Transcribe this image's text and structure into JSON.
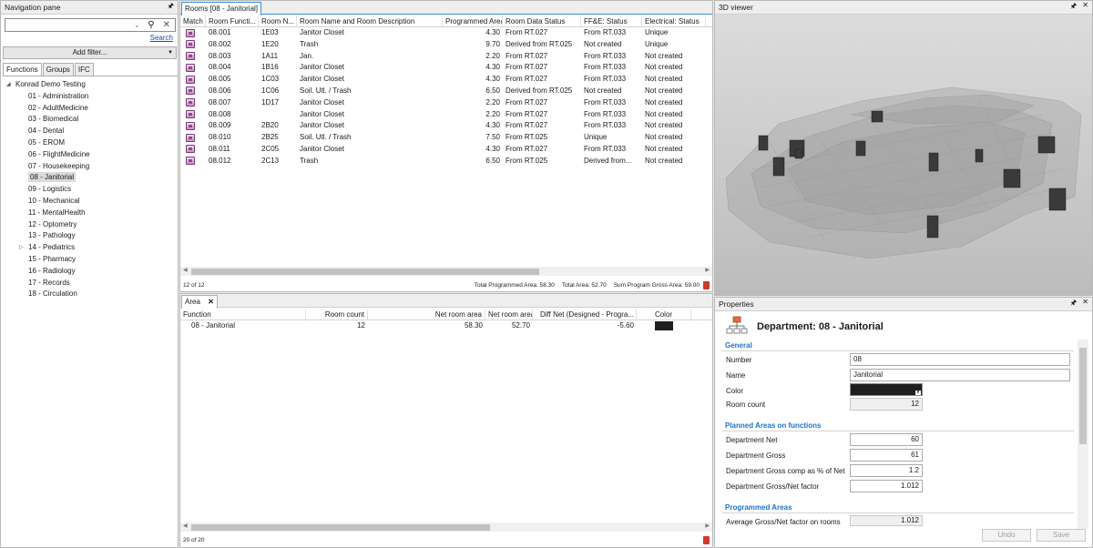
{
  "nav": {
    "title": "Navigation pane",
    "search_link": "Search",
    "add_filter": "Add filter...",
    "tabs": [
      "Functions",
      "Groups",
      "IFC"
    ],
    "root": "Konrad Demo Testing",
    "items": [
      "01 - Administration",
      "02 - AdultMedicine",
      "03 - Biomedical",
      "04 - Dental",
      "05 - EROM",
      "06 - FlightMedicine",
      "07 - Housekeeping",
      "08 - Janitorial",
      "09 - Logistics",
      "10 - Mechanical",
      "11 - MentalHealth",
      "12 - Optometry",
      "13 - Pathology",
      "14 - Pediatrics",
      "15 - Pharmacy",
      "16 - Radiology",
      "17 - Records",
      "18 - Circulation"
    ],
    "selected_index": 7
  },
  "rooms": {
    "tab": "Rooms [08 - Janitorial]",
    "columns": [
      "Match",
      "Room Functi...",
      "Room N...",
      "Room Name and Room Description",
      "Programmed Area",
      "Room Data Status",
      "FF&E: Status",
      "Electrical: Status"
    ],
    "rows": [
      [
        "08.001",
        "1E03",
        "Janitor Closet",
        "4.30",
        "From RT.027",
        "From RT.033",
        "Unique"
      ],
      [
        "08.002",
        "1E20",
        "Trash",
        "9.70",
        "Derived from RT.025",
        "Not created",
        "Unique"
      ],
      [
        "08.003",
        "1A11",
        "Jan.",
        "2.20",
        "From RT.027",
        "From RT.033",
        "Not created"
      ],
      [
        "08.004",
        "1B16",
        "Janitor Closet",
        "4.30",
        "From RT.027",
        "From RT.033",
        "Not created"
      ],
      [
        "08.005",
        "1C03",
        "Janitor Closet",
        "4.30",
        "From RT.027",
        "From RT.033",
        "Not created"
      ],
      [
        "08.006",
        "1C06",
        "Soil. Utl. / Trash",
        "6.50",
        "Derived from RT.025",
        "Not created",
        "Not created"
      ],
      [
        "08.007",
        "1D17",
        "Janitor Closet",
        "2.20",
        "From RT.027",
        "From RT.033",
        "Not created"
      ],
      [
        "08.008",
        "",
        "Janitor Closet",
        "2.20",
        "From RT.027",
        "From RT.033",
        "Not created"
      ],
      [
        "08.009",
        "2B20",
        "Janitor Closet",
        "4.30",
        "From RT.027",
        "From RT.033",
        "Not created"
      ],
      [
        "08.010",
        "2B25",
        "Soil. Utl. / Trash",
        "7.50",
        "From RT.025",
        "Unique",
        "Not created"
      ],
      [
        "08.011",
        "2C05",
        "Janitor Closet",
        "4.30",
        "From RT.027",
        "From RT.033",
        "Not created"
      ],
      [
        "08.012",
        "2C13",
        "Trash",
        "6.50",
        "From RT.025",
        "Derived from...",
        "Not created"
      ]
    ],
    "status_count": "12 of 12",
    "total_programmed": "Total Programmed Area: 58.30",
    "total_area": "Total Area: 52.70",
    "sum_gross": "Sum Program Gross Area: 59.00"
  },
  "area": {
    "tab": "Area",
    "columns": [
      "Function",
      "Room count",
      "Net room area",
      "Net room area",
      "Diff Net (Designed - Progra...",
      "Color"
    ],
    "row": {
      "function": "08 - Janitorial",
      "room_count": "12",
      "net1": "58.30",
      "net2": "52.70",
      "diff": "-5.60",
      "color": "#1f1f1f"
    },
    "status_count": "20 of 20"
  },
  "viewer": {
    "title": "3D viewer"
  },
  "props": {
    "title": "Properties",
    "dept_title": "Department: 08 - Janitorial",
    "sections": [
      "General",
      "Planned Areas on functions",
      "Programmed Areas"
    ],
    "fields": {
      "number": {
        "label": "Number",
        "value": "08"
      },
      "name": {
        "label": "Name",
        "value": "Janitorial"
      },
      "color": {
        "label": "Color",
        "value": "#1f1f1f"
      },
      "room_count": {
        "label": "Room count",
        "value": "12"
      },
      "dept_net": {
        "label": "Department Net",
        "value": "60"
      },
      "dept_gross": {
        "label": "Department Gross",
        "value": "61"
      },
      "gross_pct": {
        "label": "Department Gross comp as % of Net",
        "value": "1.2"
      },
      "gross_factor": {
        "label": "Department Gross/Net factor",
        "value": "1.012"
      },
      "avg_factor": {
        "label": "Average Gross/Net factor on rooms",
        "value": "1.012"
      }
    },
    "undo": "Undo",
    "save": "Save"
  },
  "icons": {
    "pin": "pin-icon",
    "close": "close-icon",
    "search": "search-icon",
    "clear": "clear-icon"
  }
}
